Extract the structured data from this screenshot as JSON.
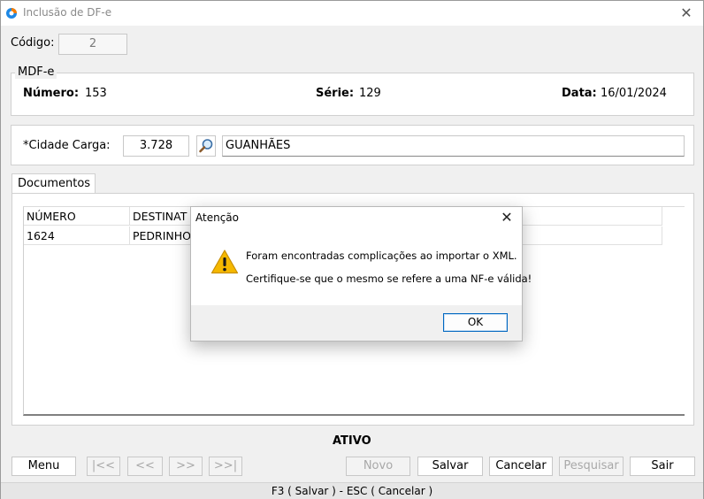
{
  "window": {
    "title": "Inclusão de DF-e"
  },
  "codigo": {
    "label": "Código:",
    "value": "2"
  },
  "mdfe": {
    "legend": "MDF-e",
    "numero_label": "Número:",
    "numero_value": "153",
    "serie_label": "Série:",
    "serie_value": "129",
    "data_label": "Data:",
    "data_value": "16/01/2024"
  },
  "cidade": {
    "label": "*Cidade Carga:",
    "code": "3.728",
    "name": "GUANHÃES"
  },
  "tabs": [
    {
      "label": "Documentos"
    }
  ],
  "grid": {
    "headers": [
      "NÚMERO",
      "DESTINAT"
    ],
    "rows": [
      [
        "1624",
        "PEDRINHO"
      ]
    ]
  },
  "status": {
    "text": "ATIVO"
  },
  "buttons": {
    "menu": "Menu",
    "first": "|<<",
    "prev": "<<",
    "next": ">>",
    "last": ">>|",
    "novo": "Novo",
    "salvar": "Salvar",
    "cancelar": "Cancelar",
    "pesquisar": "Pesquisar",
    "sair": "Sair"
  },
  "shortcuts": "F3 ( Salvar )  -  ESC ( Cancelar )",
  "dialog": {
    "title": "Atenção",
    "line1": "Foram encontradas complicações ao importar o XML.",
    "line2": "Certifique-se que o mesmo se refere a uma NF-e válida!",
    "ok": "OK"
  },
  "colors": {
    "dialog_button_border": "#0067c0",
    "warning": "#f5b800"
  },
  "icons": {
    "app": "app-logo-icon",
    "search": "magnifier-icon",
    "warning": "warning-icon",
    "close": "close-icon"
  }
}
